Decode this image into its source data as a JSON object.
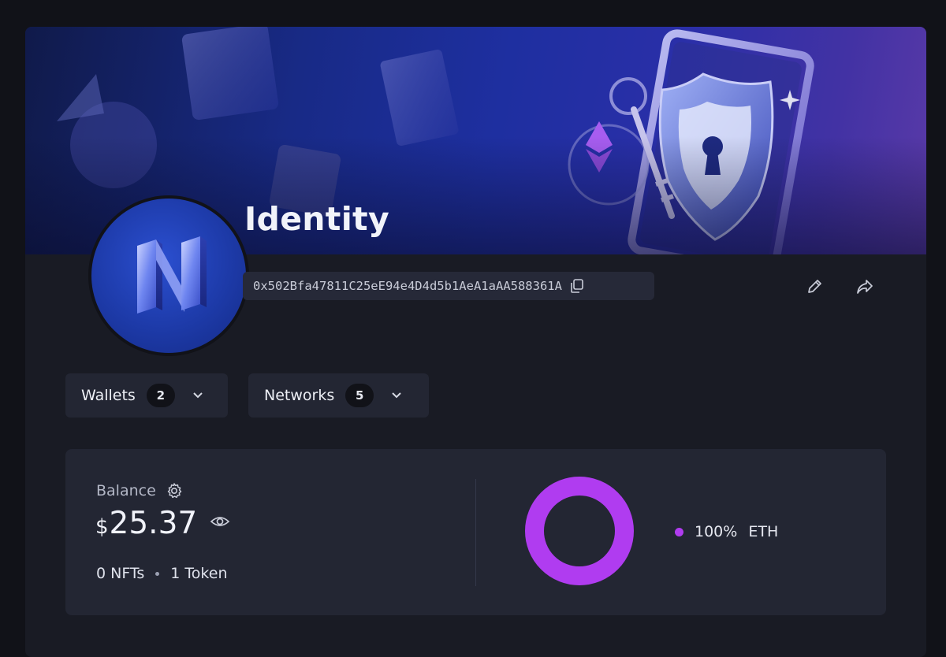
{
  "profile": {
    "name": "Identity",
    "address": "0x502Bfa47811C25eE94e4D4d5b1AeA1aAA588361A"
  },
  "icons": {
    "copy": "copy-icon",
    "edit": "pencil-icon",
    "share": "share-icon",
    "settings": "gear-icon",
    "visibility": "eye-icon",
    "dropdown": "chevron-down-icon"
  },
  "selectors": {
    "wallets": {
      "label": "Wallets",
      "count": "2"
    },
    "networks": {
      "label": "Networks",
      "count": "5"
    }
  },
  "balance": {
    "label": "Balance",
    "currency": "$",
    "amount": "25.37",
    "nfts": "0 NFTs",
    "tokens": "1 Token"
  },
  "chart_data": {
    "type": "pie",
    "categories": [
      "ETH"
    ],
    "values": [
      100
    ],
    "value_labels": [
      "100%"
    ],
    "colors": [
      "#b03cf0"
    ],
    "legend": "right"
  },
  "colors": {
    "accent": "#b03cf0",
    "background": "#111218",
    "panel": "#191b24",
    "card": "#232633"
  }
}
